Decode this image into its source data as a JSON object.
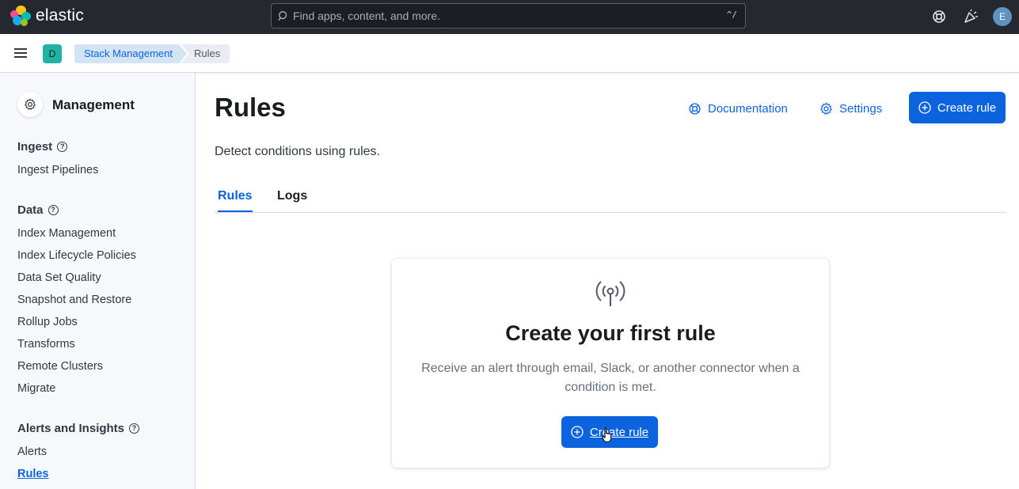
{
  "header": {
    "logo_text": "elastic",
    "search_placeholder": "Find apps, content, and more.",
    "search_shortcut": "^/",
    "avatar_initial": "E"
  },
  "breadcrumbs": {
    "space_initial": "D",
    "items": [
      "Stack Management",
      "Rules"
    ]
  },
  "sidebar": {
    "title": "Management",
    "sections": [
      {
        "title": "Ingest",
        "items": [
          "Ingest Pipelines"
        ]
      },
      {
        "title": "Data",
        "items": [
          "Index Management",
          "Index Lifecycle Policies",
          "Data Set Quality",
          "Snapshot and Restore",
          "Rollup Jobs",
          "Transforms",
          "Remote Clusters",
          "Migrate"
        ]
      },
      {
        "title": "Alerts and Insights",
        "items": [
          "Alerts",
          "Rules"
        ]
      }
    ],
    "active_item": "Rules"
  },
  "main": {
    "title": "Rules",
    "description": "Detect conditions using rules.",
    "documentation_label": "Documentation",
    "settings_label": "Settings",
    "create_rule_label": "Create rule",
    "tabs": [
      {
        "label": "Rules",
        "active": true
      },
      {
        "label": "Logs",
        "active": false
      }
    ],
    "empty_prompt": {
      "title": "Create your first rule",
      "body": "Receive an alert through email, Slack, or another connector when a condition is met.",
      "button_label": "Create rule"
    }
  },
  "colors": {
    "primary": "#0b64dd",
    "header_bg": "#25282f",
    "sidebar_bg": "#f7f8fc"
  }
}
